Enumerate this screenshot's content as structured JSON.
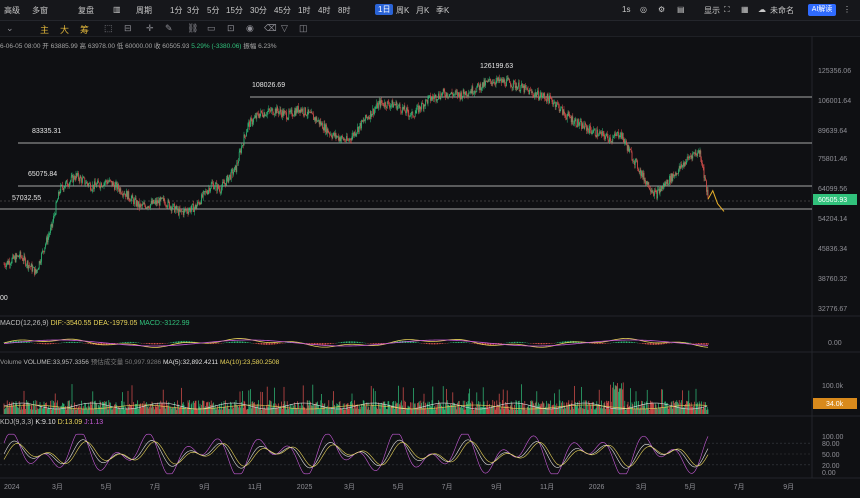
{
  "toolbar": {
    "left_items": [
      "高级",
      "多窗",
      "复盘",
      "周期",
      "1分",
      "3分",
      "5分",
      "15分",
      "30分",
      "45分",
      "1时",
      "4时",
      "8时",
      "1日",
      "周K",
      "月K",
      "季K"
    ],
    "active_period": "1日",
    "right_items": [
      "1s",
      "显示",
      "未命名"
    ],
    "ai_button": "AI解读"
  },
  "drawbar": {
    "tabs": [
      "主",
      "大",
      "筹"
    ],
    "icons": [
      "draw-tool-icon",
      "measure-icon",
      "cross-icon",
      "pen-icon",
      "link-icon",
      "note-icon",
      "lock-icon",
      "eye-icon",
      "trash-icon",
      "filter-icon",
      "layers-icon"
    ]
  },
  "info_line": {
    "date": "6-06-05 08:00",
    "open": "开 63885.99",
    "high": "高 63978.00",
    "low": "低 60000.00",
    "close": "收 60505.93",
    "change_pct": "5.29%",
    "change_abs": "(-3380.06)",
    "amplitude": "振幅 6.23%"
  },
  "chart_data": {
    "type": "candlestick",
    "timeframe": "1日",
    "x_ticks": [
      "2024",
      "3月",
      "5月",
      "7月",
      "9月",
      "11月",
      "2025",
      "3月",
      "5月",
      "7月",
      "9月",
      "11月",
      "2026",
      "3月",
      "5月",
      "7月",
      "9月"
    ],
    "x_tick_day": [
      0,
      60,
      121,
      182,
      244,
      305,
      366,
      425,
      486,
      547,
      609,
      670,
      731,
      790,
      851,
      912,
      974
    ],
    "price_axis": {
      "ticks": [
        "125356.06",
        "106001.64",
        "89639.64",
        "75801.46",
        "64099.56",
        "54204.14",
        "45836.34",
        "38760.32",
        "32776.67"
      ],
      "scale": "log",
      "current_price_label": "60505.93",
      "current_price_color": "#31c27c",
      "left_edge_label": "00"
    },
    "horizontal_levels": [
      {
        "label": "126199.63",
        "value": 126199.63
      },
      {
        "label": "108026.69",
        "value": 108026.69
      },
      {
        "label": "83335.31",
        "value": 83335.31
      },
      {
        "label": "65075.84",
        "value": 65075.84
      },
      {
        "label": "57032.55",
        "value": 57032.55
      }
    ],
    "price_path_day": [
      0,
      20,
      40,
      60,
      70,
      90,
      110,
      130,
      150,
      170,
      200,
      220,
      240,
      260,
      270,
      290,
      305,
      320,
      340,
      355,
      370,
      390,
      410,
      430,
      450,
      470,
      490,
      510,
      530,
      550,
      570,
      590,
      610,
      630,
      645,
      660,
      675,
      690,
      700,
      720,
      740,
      760,
      770,
      785,
      800,
      815,
      830,
      845,
      860,
      870,
      880
    ],
    "price_path_close": [
      42000,
      44000,
      40000,
      52000,
      64000,
      69000,
      65000,
      67000,
      63000,
      58000,
      60000,
      56000,
      58000,
      66000,
      64000,
      72000,
      92000,
      98000,
      100000,
      97000,
      101000,
      95000,
      87000,
      84000,
      94000,
      104000,
      103000,
      97000,
      106000,
      110000,
      109000,
      113000,
      118000,
      117000,
      114000,
      110000,
      108000,
      104000,
      98000,
      92000,
      88000,
      85000,
      88000,
      77000,
      68000,
      62000,
      67000,
      72000,
      78000,
      79000,
      60500
    ],
    "forecast_path_day": [
      880,
      886,
      892,
      900
    ],
    "forecast_path_close": [
      60500,
      63500,
      59000,
      56500
    ],
    "macd": {
      "title": "MACD(12,26,9)",
      "dif": "DIF:-3540.55",
      "dea": "DEA:-1979.05",
      "macd": "MACD:-3122.99",
      "axis_label": "0.00"
    },
    "volume": {
      "title": "Volume",
      "volume": "VOLUME:33,957.3356",
      "extra": "预估成交量 50,997.9286",
      "ma5": "MA(5):32,892.4211",
      "ma10": "MA(10):23,580.2508",
      "axis_label": "100.0k",
      "current_label": "34.0k"
    },
    "kdj": {
      "title": "KDJ(9,3,3)",
      "k": "K:9.10",
      "d": "D:13.09",
      "j": "J:1.13",
      "axis_labels": [
        "100.00",
        "80.00",
        "50.00",
        "20.00",
        "0.00"
      ]
    },
    "colors": {
      "up": "#31c27c",
      "down": "#e0524f",
      "dif": "#e8d45a",
      "dea": "#c75bd8",
      "accent": "#2a63d6",
      "volume_label_bg": "#d98a1c"
    }
  }
}
